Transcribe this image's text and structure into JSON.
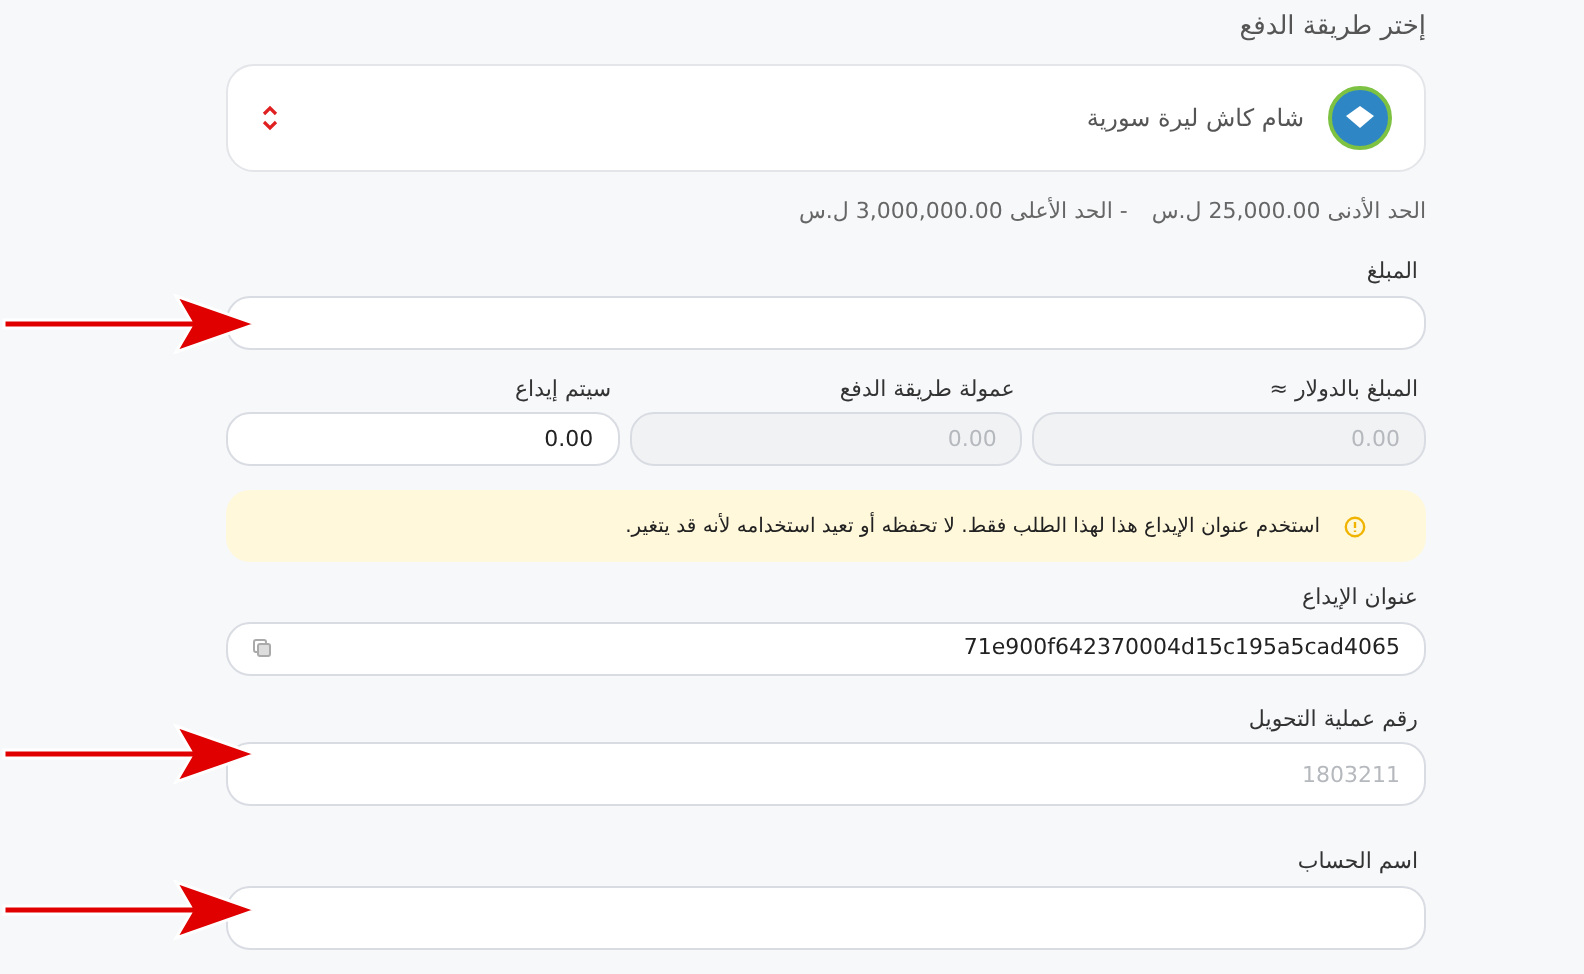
{
  "title": "إختر طريقة الدفع",
  "payment_method": {
    "label": "شام كاش ليرة سورية"
  },
  "limits": {
    "min": "الحد الأدنى 25,000.00 ل.س",
    "max": "- الحد الأعلى 3,000,000.00 ل.س"
  },
  "amount": {
    "label": "المبلغ"
  },
  "summary_fields": [
    {
      "label": "المبلغ بالدولار ≈",
      "placeholder": "0.00",
      "disabled": true
    },
    {
      "label": "عمولة طريقة الدفع",
      "placeholder": "0.00",
      "disabled": true
    },
    {
      "label": "سيتم إيداع",
      "value": "0.00",
      "disabled": false
    }
  ],
  "notice": {
    "text": "استخدم عنوان الإيداع هذا لهذا الطلب فقط. لا تحفظه أو تعيد استخدامه لأنه قد يتغير."
  },
  "deposit_address": {
    "label": "عنوان الإيداع",
    "value": "71e900f642370004d15c195a5cad4065"
  },
  "transfer_number": {
    "label": "رقم عملية التحويل",
    "placeholder": "1803211"
  },
  "account_name": {
    "label": "اسم الحساب"
  }
}
